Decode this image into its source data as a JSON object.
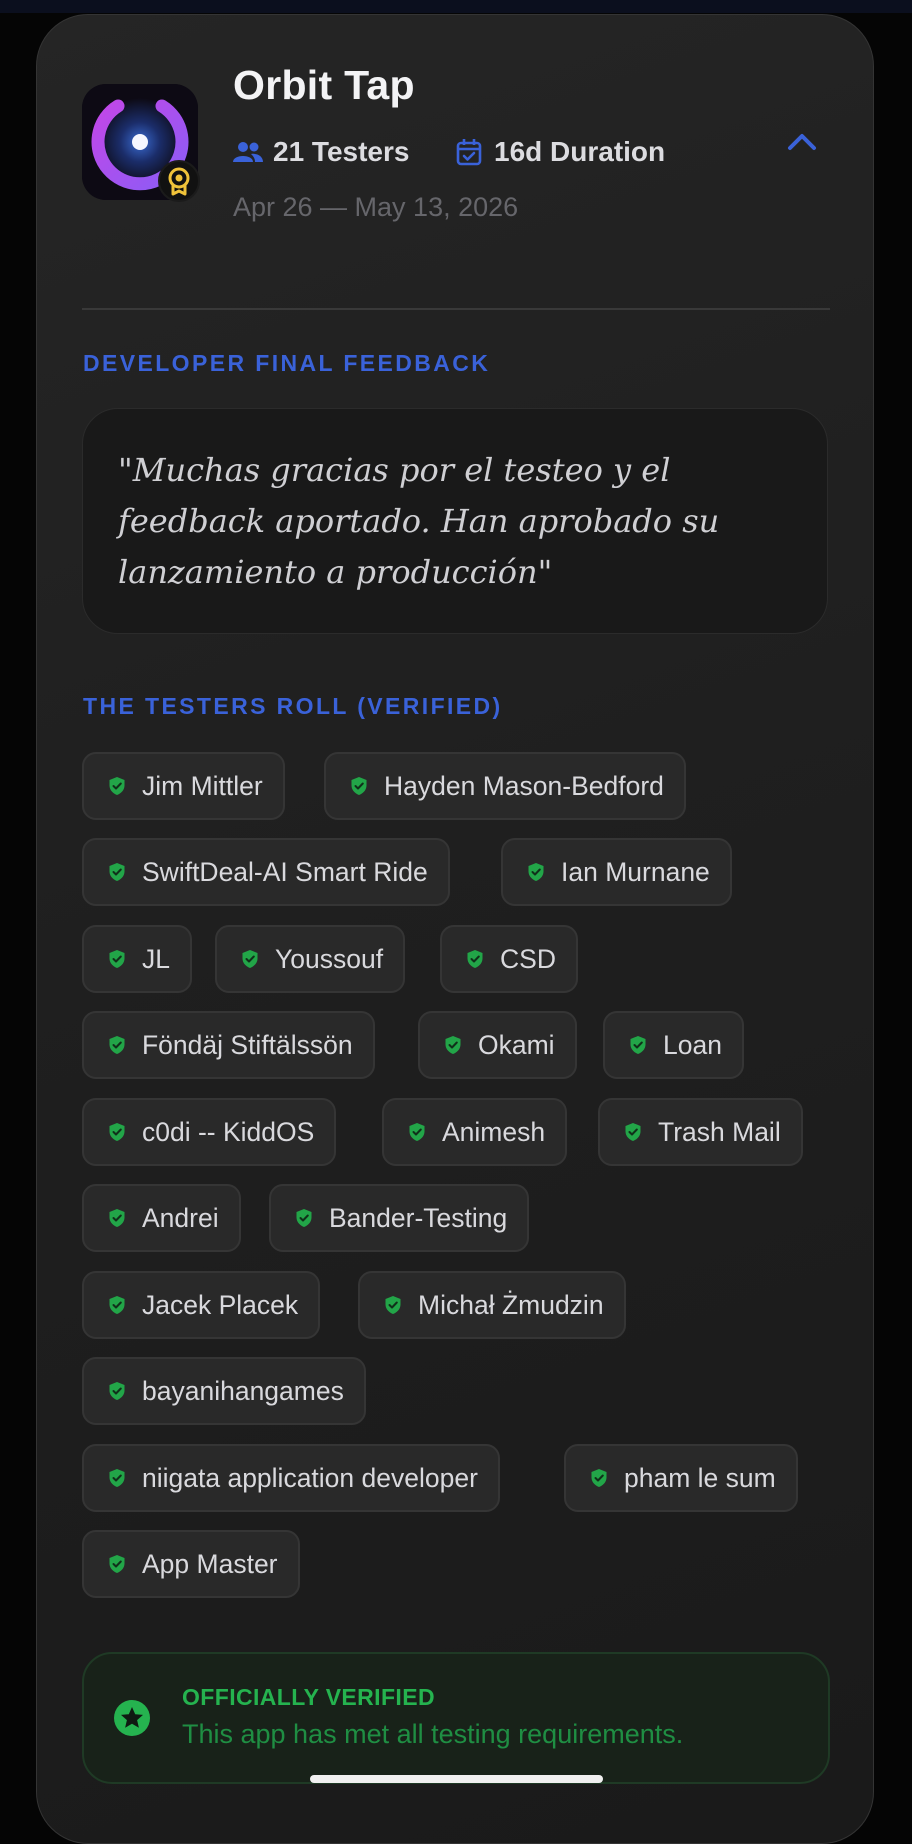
{
  "app": {
    "name": "Orbit Tap",
    "testers": "21 Testers",
    "duration": "16d Duration",
    "dates": "Apr 26 — May 13, 2026"
  },
  "feedback": {
    "label": "DEVELOPER FINAL FEEDBACK",
    "quote": "\"Muchas gracias por el testeo y el feedback aportado. Han aprobado su lanzamiento a producción\""
  },
  "testers_roll": {
    "label": "THE TESTERS ROLL (VERIFIED)",
    "names": [
      "Jim Mittler",
      "Hayden Mason-Bedford",
      "SwiftDeal-AI Smart Ride",
      "Ian Murnane",
      "JL",
      "Youssouf",
      "CSD",
      "Föndäj Stiftälssön",
      "Okami",
      "Loan",
      "c0di -- KiddOS",
      "Animesh",
      "Trash Mail",
      "Andrei",
      "Bander-Testing",
      "Jacek Placek",
      "Michał Żmudzin",
      "bayanihangames",
      "niigata application developer",
      "pham le sum",
      "App Master"
    ]
  },
  "verification": {
    "title": "OFFICIALLY VERIFIED",
    "subtitle": "This app has met all testing requirements."
  },
  "icons": {
    "app_icon": "orbit-ring-icon",
    "badge": "award-badge-icon",
    "testers": "people-icon",
    "duration": "calendar-check-icon",
    "collapse": "chevron-up-icon",
    "tester_verified": "shield-check-icon",
    "verified": "star-circle-icon"
  },
  "colors": {
    "accent": "#3a62d9",
    "success": "#25b34f",
    "background": "#1f1f1f"
  }
}
